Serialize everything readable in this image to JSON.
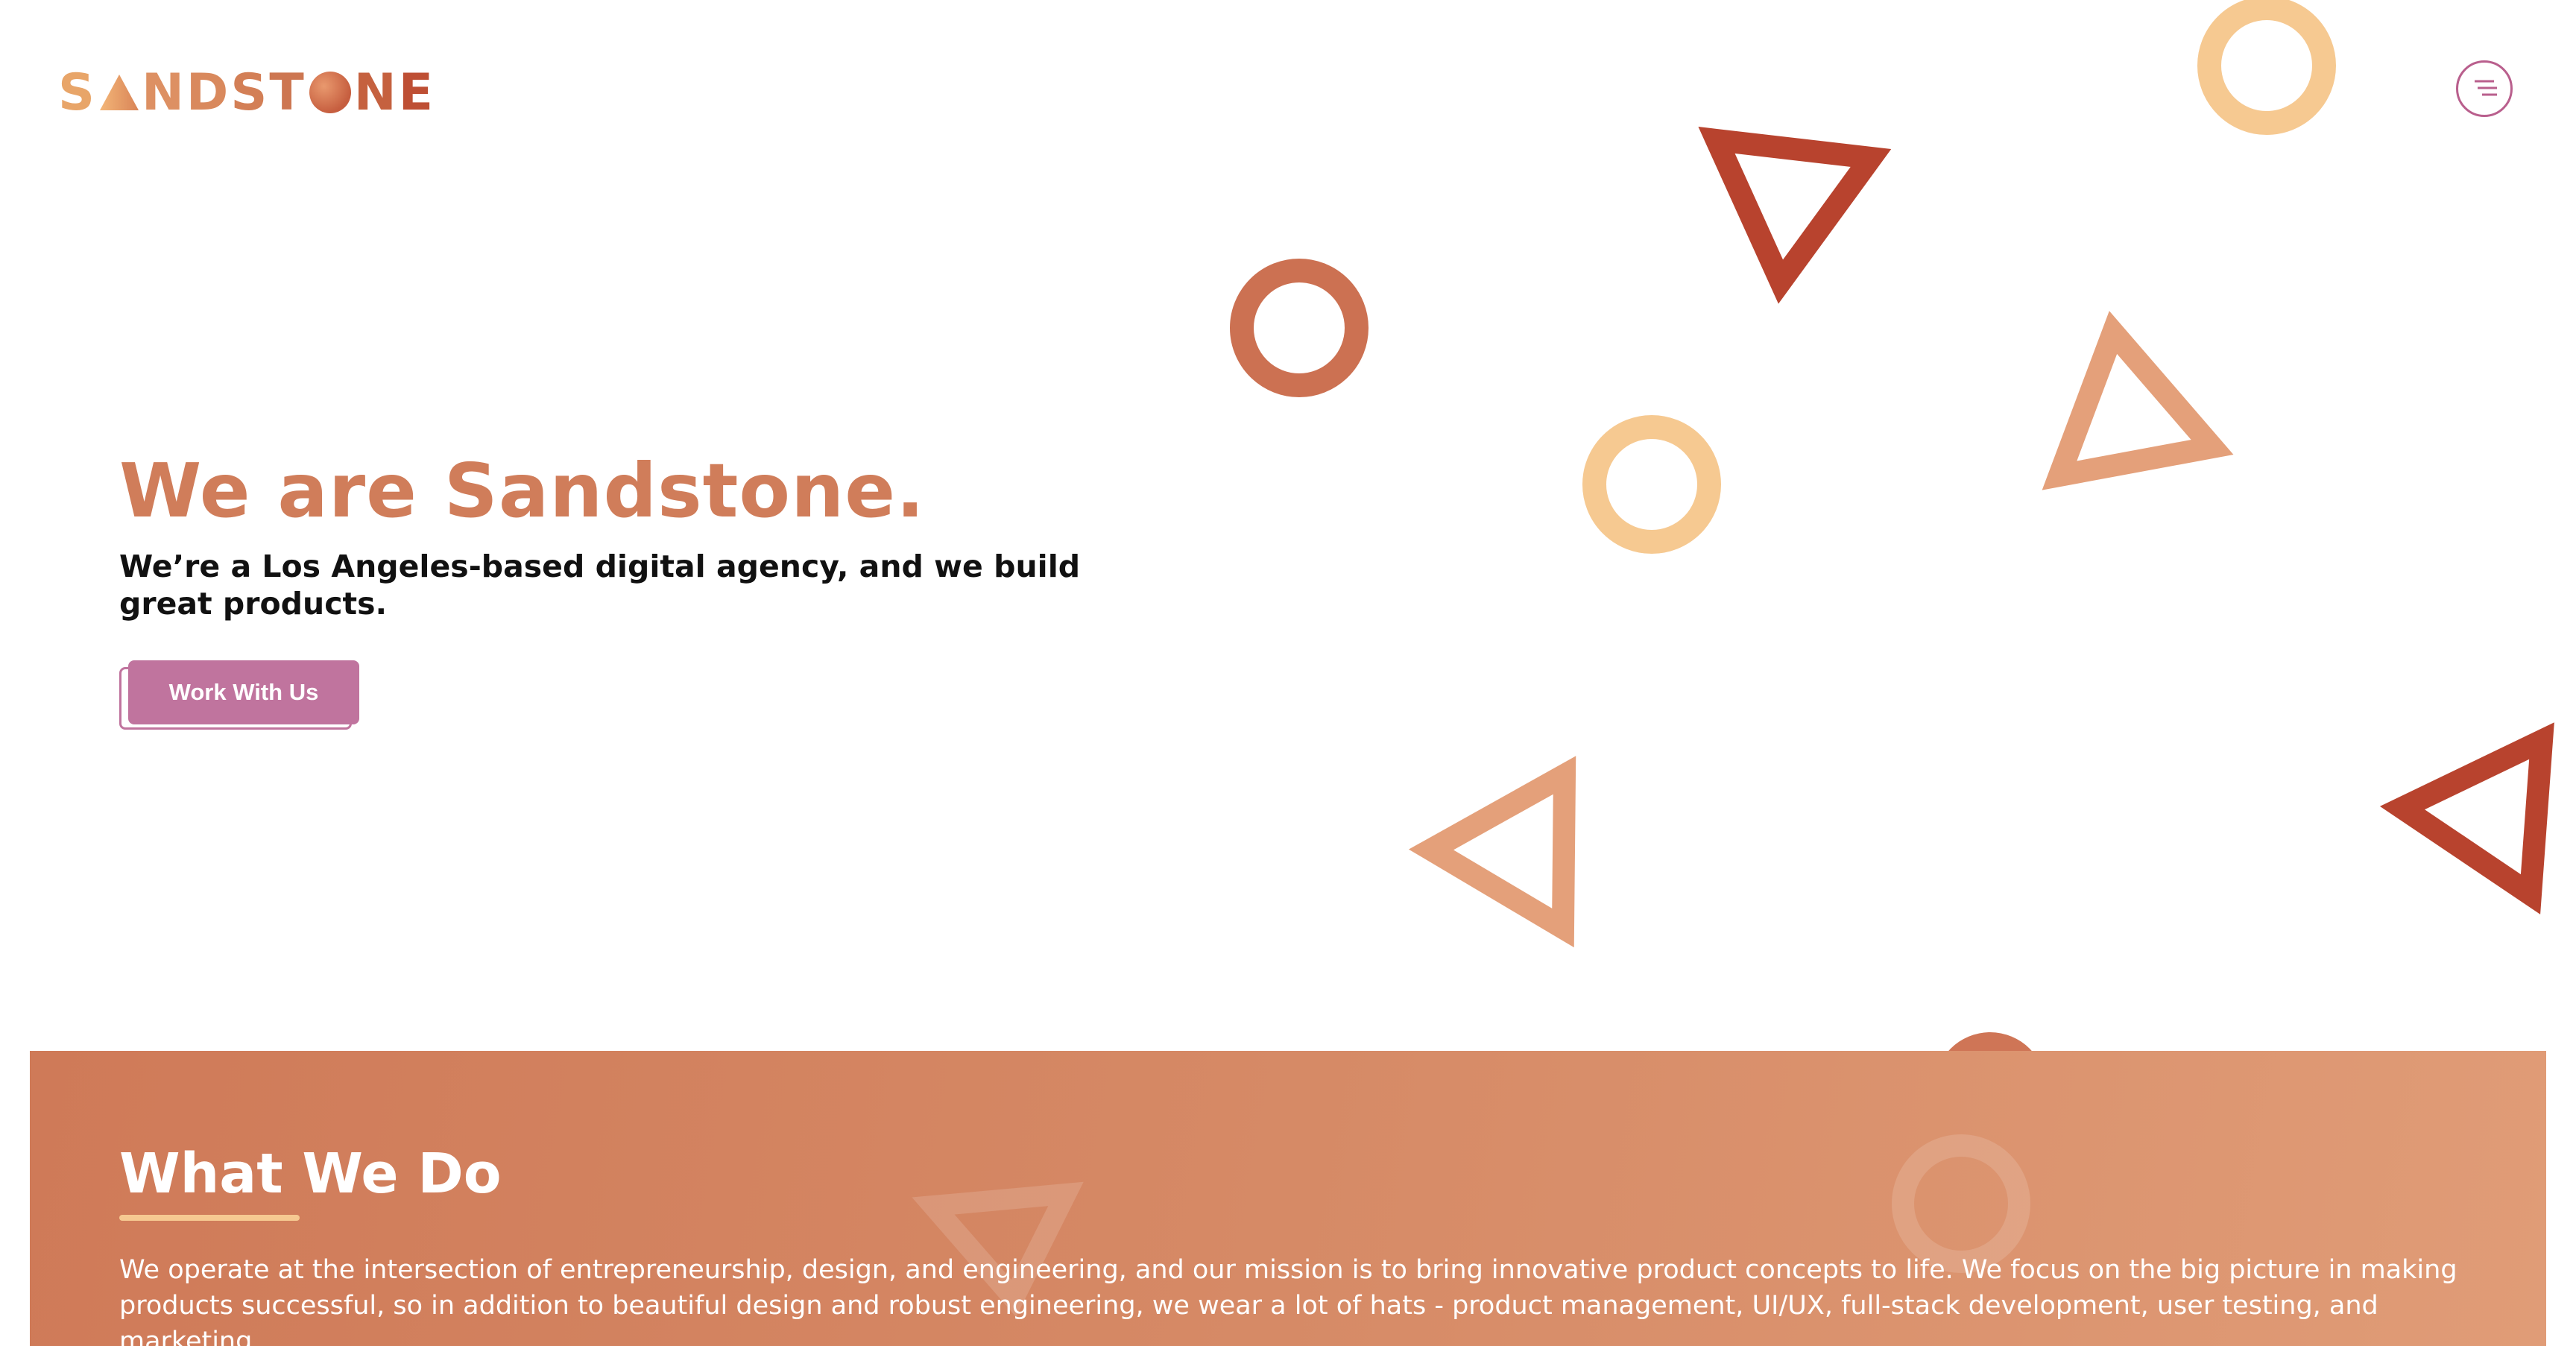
{
  "header": {
    "logo_letters": [
      "S",
      "A",
      "N",
      "D",
      "S",
      "T",
      "O",
      "N",
      "E"
    ],
    "logo_text": "SANDSTONE"
  },
  "hero": {
    "title": "We are Sandstone.",
    "subtitle": "We’re a Los Angeles-based digital agency, and we build great products.",
    "cta_label": "Work With Us"
  },
  "what_we_do": {
    "title": "What We Do",
    "body": "We operate at the intersection of entrepreneurship, design, and engineering, and our mission is to bring innovative product concepts to life. We focus on the big picture in making products successful, so in addition to beautiful design and robust engineering, we wear a lot of hats - product management, UI/UX, full-stack development, user testing, and marketing."
  },
  "colors": {
    "brand_orange": "#d07d5a",
    "brand_red": "#b8432e",
    "brand_peach": "#e4a07a",
    "brand_sand": "#f6c991",
    "button_pink": "#c0749e"
  },
  "icons": {
    "menu": "menu-lines-icon"
  }
}
